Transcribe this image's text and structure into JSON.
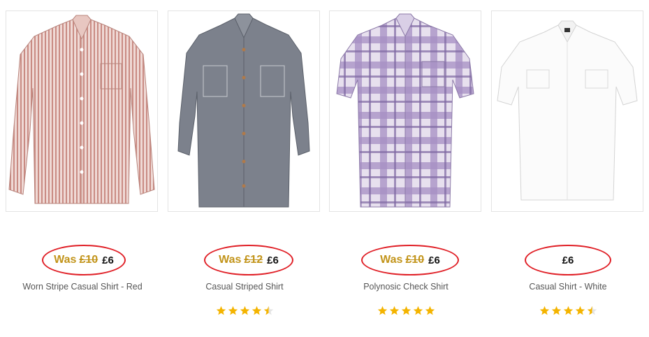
{
  "products": [
    {
      "name": "Worn Stripe Casual Shirt - Red",
      "was_label": "Was",
      "old_price": "£10",
      "price": "£6",
      "rating": null,
      "image_icon": "red-striped-long-sleeve-shirt"
    },
    {
      "name": "Casual Striped Shirt",
      "was_label": "Was",
      "old_price": "£12",
      "price": "£6",
      "rating": 4.5,
      "image_icon": "grey-chambray-long-sleeve-shirt"
    },
    {
      "name": "Polynosic Check Shirt",
      "was_label": "Was",
      "old_price": "£10",
      "price": "£6",
      "rating": 5,
      "image_icon": "purple-check-short-sleeve-shirt"
    },
    {
      "name": "Casual Shirt - White",
      "was_label": "",
      "old_price": "",
      "price": "£6",
      "rating": 4.5,
      "image_icon": "white-short-sleeve-shirt"
    }
  ],
  "colors": {
    "highlight_oval": "#e01f26",
    "was_price": "#c2941a",
    "star": "#f4b400",
    "name_text": "#555555"
  }
}
